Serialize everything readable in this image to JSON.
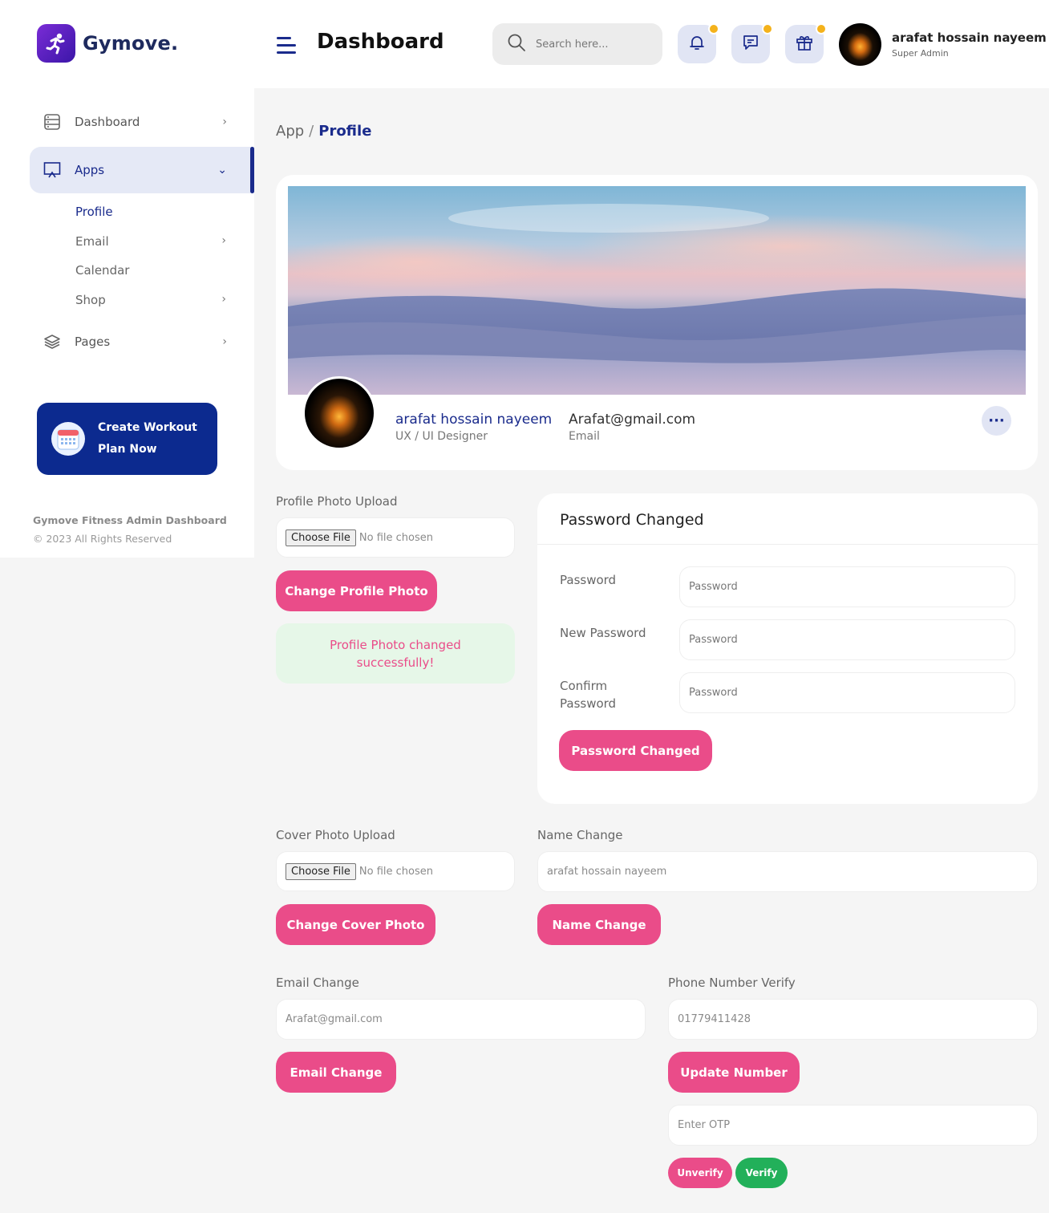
{
  "brand": {
    "name": "Gymove.",
    "logo_icon": "running-person-icon"
  },
  "sidebar": {
    "items": [
      {
        "label": "Dashboard",
        "icon": "dashboard-icon"
      },
      {
        "label": "Apps",
        "icon": "monitor-icon"
      },
      {
        "label": "Pages",
        "icon": "layers-icon"
      }
    ],
    "subitems": [
      {
        "label": "Profile"
      },
      {
        "label": "Email"
      },
      {
        "label": "Calendar"
      },
      {
        "label": "Shop"
      }
    ],
    "promo": {
      "line1": "Create Workout",
      "line2": "Plan Now",
      "icon": "calendar-icon"
    },
    "footer_title": "Gymove Fitness Admin Dashboard",
    "footer_copy": "© 2023 All Rights Reserved"
  },
  "header": {
    "title": "Dashboard",
    "search_placeholder": "Search here...",
    "user_name": "arafat hossain nayeem",
    "user_role": "Super Admin"
  },
  "breadcrumb": {
    "parent": "App",
    "separator": "/",
    "current": "Profile"
  },
  "profile": {
    "name": "arafat hossain nayeem",
    "role": "UX / UI Designer",
    "email": "Arafat@gmail.com",
    "email_label": "Email",
    "more": "···"
  },
  "profile_photo": {
    "label": "Profile Photo Upload",
    "choose": "Choose File",
    "no_file": "No file chosen",
    "button": "Change Profile Photo",
    "success": "Profile Photo changed successfully!"
  },
  "password": {
    "title": "Password Changed",
    "fields": [
      {
        "label": "Password",
        "placeholder": "Password"
      },
      {
        "label": "New Password",
        "placeholder": "Password"
      },
      {
        "label": "Confirm Password",
        "placeholder": "Password"
      }
    ],
    "button": "Password Changed"
  },
  "cover_photo": {
    "label": "Cover Photo Upload",
    "choose": "Choose File",
    "no_file": "No file chosen",
    "button": "Change Cover Photo"
  },
  "name_change": {
    "label": "Name Change",
    "placeholder": "arafat hossain nayeem",
    "button": "Name Change"
  },
  "email_change": {
    "label": "Email Change",
    "placeholder": "Arafat@gmail.com",
    "button": "Email Change"
  },
  "phone": {
    "label": "Phone Number Verify",
    "placeholder": "01779411428",
    "button": "Update Number",
    "otp_placeholder": "Enter OTP",
    "unverify": "Unverify",
    "verify": "Verify"
  },
  "colors": {
    "primary": "#1a2b8c",
    "accent_pink": "#ea4c89",
    "success_bg": "#e6f7e8",
    "verify_green": "#22b05a",
    "notify_dot": "#f4b21b"
  }
}
